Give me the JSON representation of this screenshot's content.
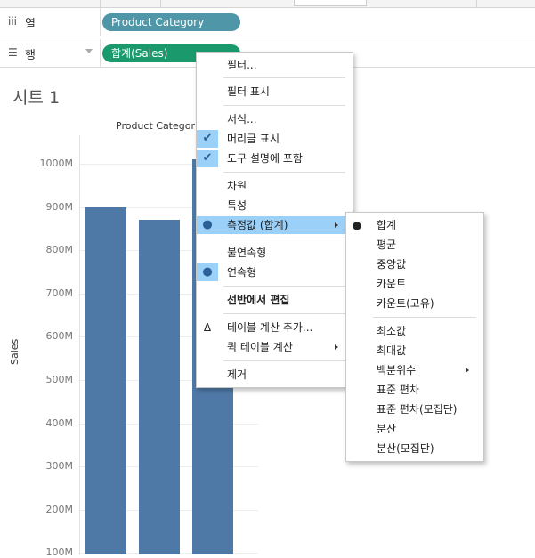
{
  "shelves": {
    "columns": {
      "icon": "columns-icon",
      "glyph": "iii",
      "label": "열",
      "pill": "Product Category"
    },
    "rows": {
      "icon": "rows-icon",
      "glyph": "☰",
      "label": "행",
      "pill": "합계(Sales)"
    }
  },
  "sheet": {
    "title": "시트 1"
  },
  "chart_data": {
    "type": "bar",
    "header": "Product Categor",
    "ylabel": "Sales",
    "yticks": [
      "1000M",
      "900M",
      "800M",
      "700M",
      "600M",
      "500M",
      "400M",
      "300M",
      "200M",
      "100M"
    ],
    "ylim": [
      100,
      1000
    ],
    "values": [
      900,
      870,
      1010
    ],
    "color": "#4e79a7"
  },
  "context_menu": {
    "items": [
      {
        "label": "필터..."
      },
      {
        "label": "필터 표시"
      },
      {
        "label": "서식..."
      },
      {
        "label": "머리글 표시",
        "mark": "✔"
      },
      {
        "label": "도구 설명에 포함",
        "mark": "✔"
      },
      {
        "label": "차원"
      },
      {
        "label": "특성"
      },
      {
        "label": "측정값 (합계)",
        "mark": "●"
      },
      {
        "label": "불연속형"
      },
      {
        "label": "연속형",
        "mark": "●"
      },
      {
        "label": "선반에서 편집"
      },
      {
        "label": "테이블 계산 추가...",
        "mark": "Δ"
      },
      {
        "label": "퀵 테이블 계산"
      },
      {
        "label": "제거"
      }
    ]
  },
  "submenu": {
    "items": [
      {
        "label": "합계",
        "mark": "●"
      },
      {
        "label": "평균"
      },
      {
        "label": "중앙값"
      },
      {
        "label": "카운트"
      },
      {
        "label": "카운트(고유)"
      },
      {
        "label": "최소값"
      },
      {
        "label": "최대값"
      },
      {
        "label": "백분위수"
      },
      {
        "label": "표준 편차"
      },
      {
        "label": "표준 편차(모집단)"
      },
      {
        "label": "분산"
      },
      {
        "label": "분산(모집단)"
      }
    ]
  }
}
